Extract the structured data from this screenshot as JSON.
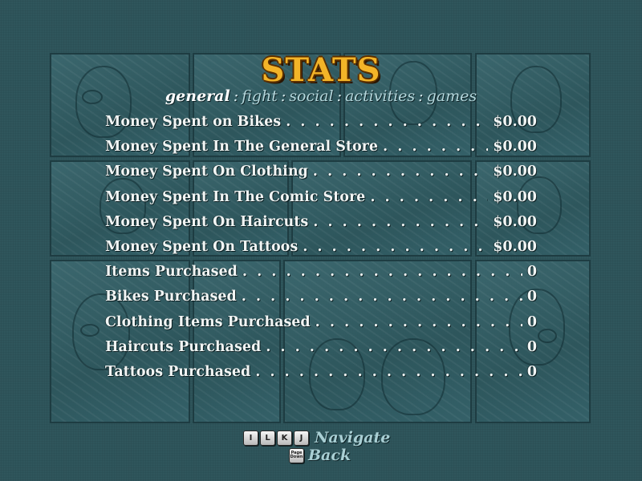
{
  "title": "STATS",
  "tabs": [
    {
      "label": "general",
      "active": true
    },
    {
      "label": "fight",
      "active": false
    },
    {
      "label": "social",
      "active": false
    },
    {
      "label": "activities",
      "active": false
    },
    {
      "label": "games",
      "active": false
    }
  ],
  "separator": ":",
  "stats": [
    {
      "label": "Money Spent on Bikes",
      "value": "$0.00"
    },
    {
      "label": "Money Spent In The General Store",
      "value": "$0.00"
    },
    {
      "label": "Money Spent On Clothing",
      "value": "$0.00"
    },
    {
      "label": "Money Spent In The Comic Store",
      "value": "$0.00"
    },
    {
      "label": "Money Spent On Haircuts",
      "value": "$0.00"
    },
    {
      "label": "Money Spent On Tattoos",
      "value": "$0.00"
    },
    {
      "label": "Items Purchased",
      "value": "0"
    },
    {
      "label": "Bikes Purchased",
      "value": "0"
    },
    {
      "label": "Clothing Items Purchased",
      "value": "0"
    },
    {
      "label": "Haircuts Purchased",
      "value": "0"
    },
    {
      "label": "Tattoos Purchased",
      "value": "0"
    }
  ],
  "controls": {
    "navigate_keys": [
      "I",
      "L",
      "K",
      "J"
    ],
    "navigate_label": "Navigate",
    "back_key": "Page Down",
    "back_label": "Back"
  },
  "colors": {
    "background": "#2f565c",
    "title": "#f3b428",
    "active_tab": "#ffffff",
    "inactive_tab": "#b5d7dc",
    "row_text": "#f1f5f4"
  }
}
